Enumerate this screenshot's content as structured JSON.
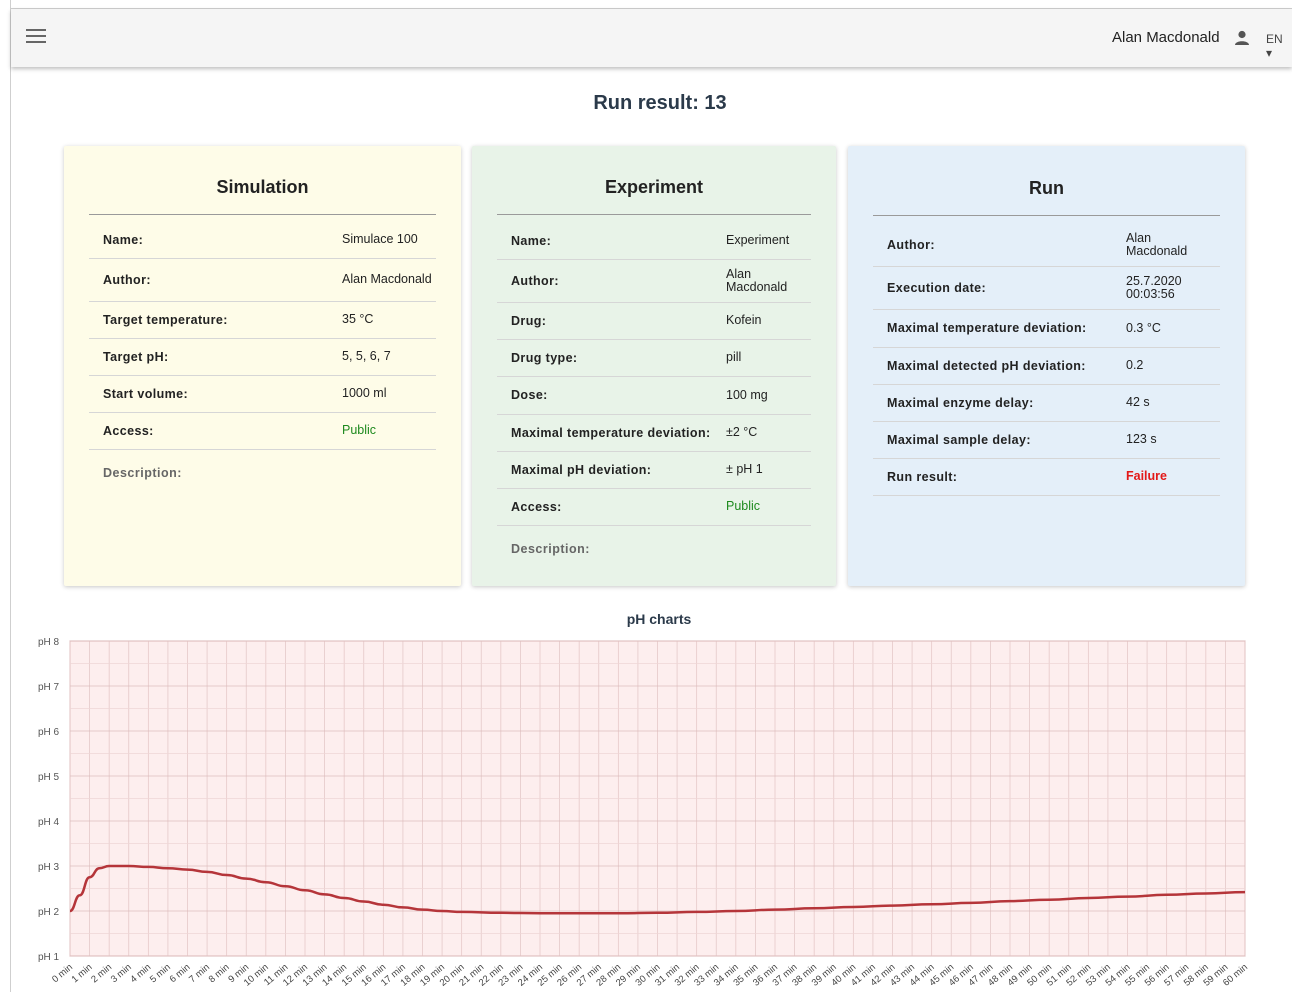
{
  "header": {
    "user_name": "Alan Macdonald",
    "lang": "EN ▾"
  },
  "page": {
    "title": "Run result: 13"
  },
  "simulation": {
    "title": "Simulation",
    "rows": [
      {
        "label": "Name:",
        "value": "Simulace 100"
      },
      {
        "label": "Author:",
        "value": "Alan Macdonald"
      },
      {
        "label": "Target temperature:",
        "value": "35 °C"
      },
      {
        "label": "Target pH:",
        "value": "5, 5, 6, 7"
      },
      {
        "label": "Start volume:",
        "value": "1000 ml"
      },
      {
        "label": "Access:",
        "value": "Public"
      }
    ],
    "description_label": "Description:"
  },
  "experiment": {
    "title": "Experiment",
    "rows": [
      {
        "label": "Name:",
        "value": "Experiment"
      },
      {
        "label": "Author:",
        "value": "Alan Macdonald"
      },
      {
        "label": "Drug:",
        "value": "Kofein"
      },
      {
        "label": "Drug type:",
        "value": "pill"
      },
      {
        "label": "Dose:",
        "value": "100 mg"
      },
      {
        "label": "Maximal temperature deviation:",
        "value": "±2 °C"
      },
      {
        "label": "Maximal pH deviation:",
        "value": "± pH 1"
      },
      {
        "label": "Access:",
        "value": "Public"
      }
    ],
    "description_label": "Description:"
  },
  "run": {
    "title": "Run",
    "rows": [
      {
        "label": "Author:",
        "value": "Alan Macdonald"
      },
      {
        "label": "Execution date:",
        "value": "25.7.2020 00:03:56"
      },
      {
        "label": "Maximal temperature deviation:",
        "value": "0.3 °C"
      },
      {
        "label": "Maximal detected pH deviation:",
        "value": "0.2"
      },
      {
        "label": "Maximal enzyme delay:",
        "value": "42 s"
      },
      {
        "label": "Maximal sample delay:",
        "value": "123 s"
      },
      {
        "label": "Run result:",
        "value": "Failure"
      }
    ]
  },
  "colors": {
    "simulation_bg": "#fefce8",
    "experiment_bg": "#e8f3e8",
    "run_bg": "#e4eff9",
    "public_green": "#1e8a1e",
    "failure_red": "#e31919",
    "chart_line": "#b5353a",
    "chart_bg": "#fdeeee"
  },
  "chart_data": {
    "type": "line",
    "title": "pH charts",
    "y_ticks": [
      "pH 1",
      "pH 2",
      "pH 3",
      "pH 4",
      "pH 5",
      "pH 6",
      "pH 7",
      "pH 8"
    ],
    "ylim": [
      1,
      8
    ],
    "x_ticks": [
      "0 min",
      "1 min",
      "2 min",
      "3 min",
      "4 min",
      "5 min",
      "6 min",
      "7 min",
      "8 min",
      "9 min",
      "10 min",
      "11 min",
      "12 min",
      "13 min",
      "14 min",
      "15 min",
      "16 min",
      "17 min",
      "18 min",
      "19 min",
      "20 min",
      "21 min",
      "22 min",
      "23 min",
      "24 min",
      "25 min",
      "26 min",
      "27 min",
      "28 min",
      "29 min",
      "30 min",
      "31 min",
      "32 min",
      "33 min",
      "34 min",
      "35 min",
      "36 min",
      "37 min",
      "38 min",
      "39 min",
      "40 min",
      "41 min",
      "42 min",
      "43 min",
      "44 min",
      "45 min",
      "46 min",
      "47 min",
      "48 min",
      "49 min",
      "50 min",
      "51 min",
      "52 min",
      "53 min",
      "54 min",
      "55 min",
      "56 min",
      "57 min",
      "58 min",
      "59 min",
      "60 min"
    ],
    "xlim": [
      0,
      60
    ],
    "grid": true,
    "series": [
      {
        "x": [
          0,
          0.5,
          1,
          1.5,
          2,
          3,
          4,
          5,
          6,
          7,
          8,
          9,
          10,
          11,
          12,
          13,
          14,
          15,
          16,
          17,
          18,
          19,
          20,
          22,
          24,
          26,
          28,
          30,
          32,
          34,
          36,
          38,
          40,
          42,
          44,
          46,
          48,
          50,
          52,
          54,
          56,
          58,
          60
        ],
        "values": [
          2.0,
          2.35,
          2.75,
          2.95,
          3.0,
          3.0,
          2.98,
          2.95,
          2.92,
          2.87,
          2.8,
          2.72,
          2.64,
          2.55,
          2.46,
          2.37,
          2.29,
          2.21,
          2.14,
          2.08,
          2.03,
          2.0,
          1.98,
          1.96,
          1.95,
          1.95,
          1.95,
          1.96,
          1.98,
          2.0,
          2.03,
          2.06,
          2.09,
          2.12,
          2.15,
          2.18,
          2.22,
          2.25,
          2.29,
          2.32,
          2.36,
          2.39,
          2.42
        ]
      }
    ]
  }
}
